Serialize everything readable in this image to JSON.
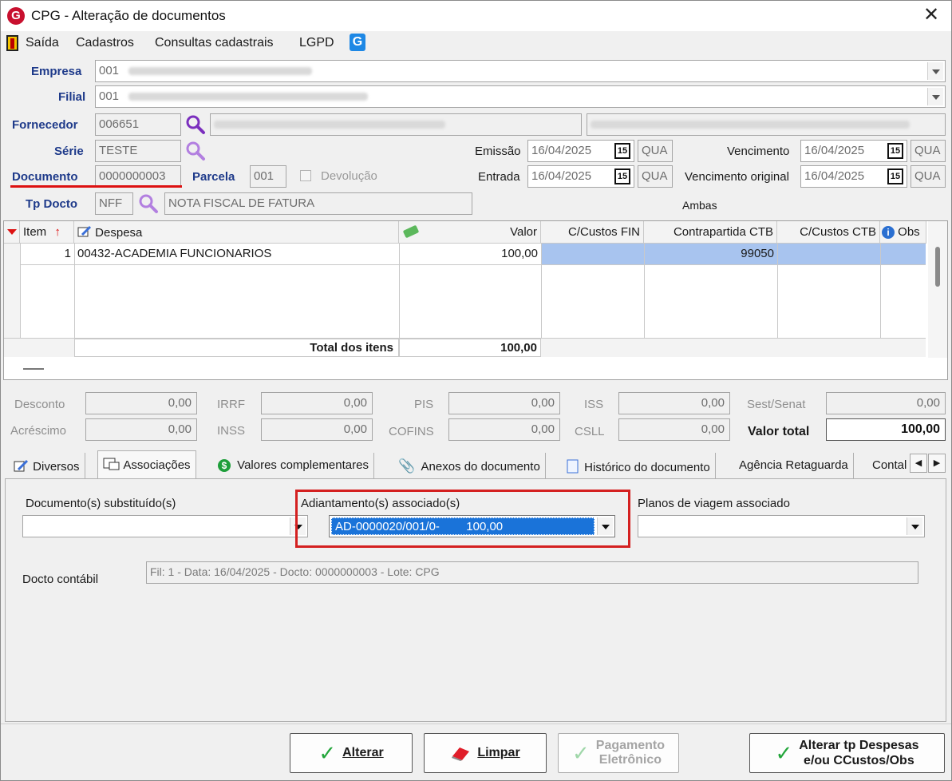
{
  "window": {
    "title": "CPG - Alteração de documentos",
    "close_label": "✕"
  },
  "menu": [
    "Saída",
    "Cadastros",
    "Consultas cadastrais",
    "LGPD"
  ],
  "form": {
    "empresa": {
      "label": "Empresa",
      "code": "001"
    },
    "filial": {
      "label": "Filial",
      "code": "001"
    },
    "fornecedor": {
      "label": "Fornecedor",
      "code": "006651"
    },
    "serie": {
      "label": "Série",
      "value": "TESTE"
    },
    "documento": {
      "label": "Documento",
      "value": "0000000003"
    },
    "parcela": {
      "label": "Parcela",
      "value": "001"
    },
    "devolucao_label": "Devolução",
    "tp_docto": {
      "label": "Tp Docto",
      "code": "NFF",
      "description": "NOTA FISCAL DE FATURA"
    },
    "emissao": {
      "label": "Emissão",
      "date": "16/04/2025",
      "weekday": "QUA"
    },
    "entrada": {
      "label": "Entrada",
      "date": "16/04/2025",
      "weekday": "QUA"
    },
    "vencimento": {
      "label": "Vencimento",
      "date": "16/04/2025",
      "weekday": "QUA"
    },
    "vencimento_original": {
      "label": "Vencimento original",
      "date": "16/04/2025",
      "weekday": "QUA"
    },
    "ambas_label": "Ambas",
    "cal_glyph": "15"
  },
  "grid": {
    "columns": [
      "Item",
      "Despesa",
      "Valor",
      "C/Custos FIN",
      "Contrapartida CTB",
      "C/Custos CTB",
      "Obs"
    ],
    "rows": [
      {
        "item": "1",
        "despesa": "00432-ACADEMIA FUNCIONARIOS",
        "valor": "100,00",
        "ccustos_fin": "",
        "contrapartida": "99050",
        "ccustos_ctb": ""
      }
    ],
    "total_label": "Total dos itens",
    "total_value": "100,00"
  },
  "taxes": {
    "desconto": {
      "label": "Desconto",
      "value": "0,00"
    },
    "acrescimo": {
      "label": "Acréscimo",
      "value": "0,00"
    },
    "irrf": {
      "label": "IRRF",
      "value": "0,00"
    },
    "inss": {
      "label": "INSS",
      "value": "0,00"
    },
    "pis": {
      "label": "PIS",
      "value": "0,00"
    },
    "cofins": {
      "label": "COFINS",
      "value": "0,00"
    },
    "iss": {
      "label": "ISS",
      "value": "0,00"
    },
    "csll": {
      "label": "CSLL",
      "value": "0,00"
    },
    "sest_senat": {
      "label": "Sest/Senat",
      "value": "0,00"
    },
    "valor_total": {
      "label": "Valor total",
      "value": "100,00"
    }
  },
  "tabs": [
    "Diversos",
    "Associações",
    "Valores complementares",
    "Anexos do documento",
    "Histórico do documento",
    "Agência Retaguarda",
    "Contal"
  ],
  "assoc": {
    "doc_substituidos_label": "Documento(s) substituído(s)",
    "adiantamentos_label": "Adiantamento(s) associado(s)",
    "adiantamento_selected": "AD-0000020/001/0-        100,00",
    "planos_label": "Planos de viagem associado",
    "docto_contabil_label": "Docto contábil",
    "docto_contabil_value": "Fil: 1 - Data: 16/04/2025 - Docto: 0000000003 - Lote: CPG"
  },
  "buttons": {
    "alterar": "Alterar",
    "limpar": "Limpar",
    "pagamento_line1": "Pagamento",
    "pagamento_line2": "Eletrônico",
    "alterar_tp_line1": "Alterar tp Despesas",
    "alterar_tp_line2": "e/ou CCustos/Obs"
  },
  "colors": {
    "accent_blue": "#1a73d9",
    "label_blue": "#1e3a8a",
    "highlight_red": "#d42020",
    "check_green": "#22a63a"
  }
}
